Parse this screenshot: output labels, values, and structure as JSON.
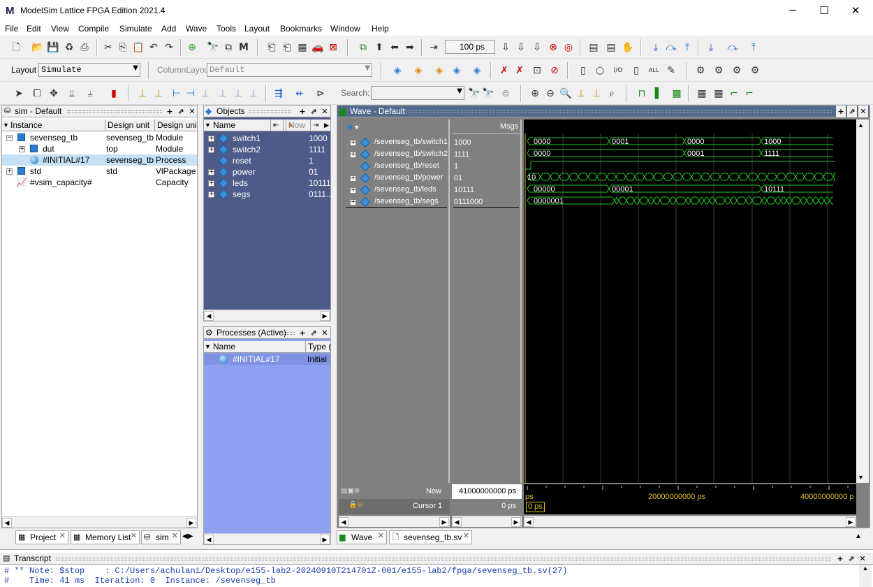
{
  "app": {
    "title": "ModelSim Lattice FPGA Edition 2021.4",
    "logo": "M"
  },
  "window_controls": {
    "minimize": "─",
    "maximize": "☐",
    "close": "✕"
  },
  "menus": [
    "File",
    "Edit",
    "View",
    "Compile",
    "Simulate",
    "Add",
    "Wave",
    "Tools",
    "Layout",
    "Bookmarks",
    "Window",
    "Help"
  ],
  "toolbar": {
    "run_length": "100 ps",
    "layout_label": "Layout",
    "layout_value": "Simulate",
    "column_layout_label": "ColumnLayout",
    "column_layout_value": "Default",
    "search_label": "Search:",
    "search_value": ""
  },
  "sim_panel": {
    "title": "sim - Default",
    "columns": [
      "Instance",
      "Design unit",
      "Design unit t"
    ],
    "rows": [
      {
        "instance": "sevenseg_tb",
        "design_unit": "sevenseg_tb",
        "type": "Module"
      },
      {
        "instance": "dut",
        "design_unit": "top",
        "type": "Module"
      },
      {
        "instance": "#INITIAL#17",
        "design_unit": "sevenseg_tb",
        "type": "Process"
      },
      {
        "instance": "std",
        "design_unit": "std",
        "type": "VlPackage"
      },
      {
        "instance": "#vsim_capacity#",
        "design_unit": "",
        "type": "Capacity"
      }
    ],
    "tabs": [
      "Project",
      "Memory List",
      "sim"
    ]
  },
  "objects_panel": {
    "title": "Objects",
    "name_header": "Name",
    "now_label": "Now",
    "rows": [
      {
        "name": "switch1",
        "value": "1000"
      },
      {
        "name": "switch2",
        "value": "1111"
      },
      {
        "name": "reset",
        "value": "1"
      },
      {
        "name": "power",
        "value": "01"
      },
      {
        "name": "leds",
        "value": "10111"
      },
      {
        "name": "segs",
        "value": "0111..."
      }
    ]
  },
  "processes_panel": {
    "title": "Processes (Active)",
    "columns": [
      "Name",
      "Type ("
    ],
    "rows": [
      {
        "name": "#INITIAL#17",
        "type": "Initial"
      }
    ]
  },
  "wave_panel": {
    "title": "Wave - Default",
    "msgs_header": "Msgs",
    "signals": [
      {
        "path": "/sevenseg_tb/switch1",
        "value": "1000"
      },
      {
        "path": "/sevenseg_tb/switch2",
        "value": "1111"
      },
      {
        "path": "/sevenseg_tb/reset",
        "value": "1"
      },
      {
        "path": "/sevenseg_tb/power",
        "value": "01"
      },
      {
        "path": "/sevenseg_tb/leds",
        "value": "10111"
      },
      {
        "path": "/sevenseg_tb/segs",
        "value": "0111000"
      }
    ],
    "wave_labels": {
      "switch1": [
        "0000",
        "0001",
        "0000",
        "1000"
      ],
      "switch2": [
        "0000",
        "0001",
        "1111"
      ],
      "power": [
        "10"
      ],
      "leds": [
        "00000",
        "00001",
        "10111"
      ],
      "segs": [
        "0000001"
      ]
    },
    "now_label": "Now",
    "now_value": "41000000000 ps",
    "cursor_label": "Cursor 1",
    "cursor_value": "0 ps",
    "timeline": [
      "ps",
      "20000000000 ps",
      "40000000000 p"
    ],
    "cursor_marker": "0 ps",
    "tabs": [
      "Wave",
      "sevenseg_tb.sv"
    ]
  },
  "transcript": {
    "title": "Transcript",
    "lines": [
      "# ** Note: $stop    : C:/Users/achulani/Desktop/e155-lab2-20240910T214701Z-001/e155-lab2/fpga/sevenseg_tb.sv(27)",
      "#    Time: 41 ms  Iteration: 0  Instance: /sevenseg_tb"
    ]
  },
  "colors": {
    "objects_bg": "#4e5a89",
    "processes_bg": "#8ea1f0",
    "wave_names_bg": "#808080",
    "wave_canvas_bg": "#000000",
    "wave_line": "#22c922",
    "transcript_text": "#1b3fb5"
  }
}
